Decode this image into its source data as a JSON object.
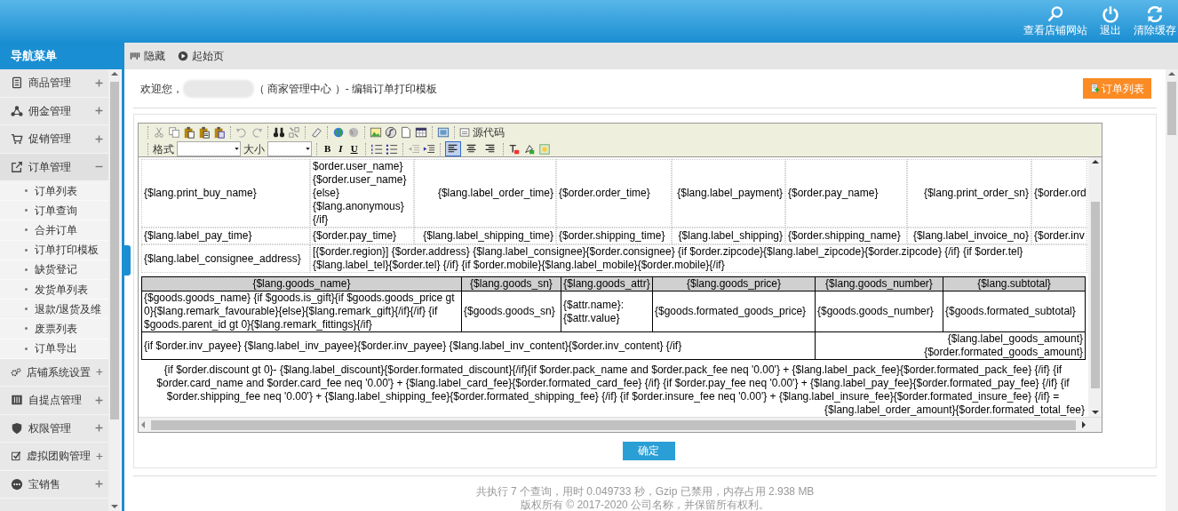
{
  "header": {
    "actions": [
      {
        "kind": "search",
        "label": "查看店铺网站"
      },
      {
        "kind": "power",
        "label": "退出"
      },
      {
        "kind": "refresh",
        "label": "清除缓存"
      }
    ]
  },
  "sidebar": {
    "title": "导航菜单",
    "items": [
      {
        "label": "商品管理",
        "expanded": false
      },
      {
        "label": "佣金管理",
        "expanded": false
      },
      {
        "label": "促销管理",
        "expanded": false
      },
      {
        "label": "订单管理",
        "expanded": true,
        "children": [
          {
            "label": "订单列表"
          },
          {
            "label": "订单查询"
          },
          {
            "label": "合并订单"
          },
          {
            "label": "订单打印模板"
          },
          {
            "label": "缺货登记"
          },
          {
            "label": "发货单列表"
          },
          {
            "label": "退款/退货及维"
          },
          {
            "label": "废票列表"
          },
          {
            "label": "订单导出"
          }
        ]
      },
      {
        "label": "店铺系统设置",
        "expanded": false
      },
      {
        "label": "自提点管理",
        "expanded": false
      },
      {
        "label": "权限管理",
        "expanded": false
      },
      {
        "label": "虚拟团购管理",
        "expanded": false
      },
      {
        "label": "宝销售",
        "expanded": false
      }
    ]
  },
  "tabbar": {
    "items": [
      {
        "kind": "hide",
        "label": "隐藏"
      },
      {
        "kind": "start",
        "label": "起始页"
      }
    ]
  },
  "welcome": {
    "prefix": "欢迎您，",
    "suffix": "（ 商家管理中心 ）- 编辑订单打印模板"
  },
  "list_button": "订单列表",
  "editor": {
    "source_label": "源代码",
    "format_label": "格式",
    "size_label": "大小",
    "style_buttons": [
      "B",
      "I",
      "U"
    ],
    "align": [
      {
        "selected": true
      },
      {
        "selected": false
      },
      {
        "selected": false
      }
    ],
    "info_rows": [
      [
        "{$lang.print_buy_name}",
        "$order.user_name} {$order.user_name} {else} {$lang.anonymous} {/if}",
        "{$lang.label_order_time}",
        "{$order.order_time}",
        "{$lang.label_payment}",
        "{$order.pay_name}",
        "{$lang.print_order_sn}",
        "{$order.ord"
      ],
      [
        "{$lang.label_pay_time}",
        "{$order.pay_time}",
        "{$lang.label_shipping_time}",
        "{$order.shipping_time}",
        "{$lang.label_shipping}",
        "{$order.shipping_name}",
        "{$lang.label_invoice_no}",
        "{$order.inv"
      ],
      [
        "{$lang.label_consignee_address}",
        "[{$order.region}] {$order.address} {$lang.label_consignee}{$order.consignee}  {if $order.zipcode}{$lang.label_zipcode}{$order.zipcode} {/if} {if $order.tel} {$lang.label_tel}{$order.tel} {/if} {if $order.mobile}{$lang.label_mobile}{$order.mobile}{/if}"
      ]
    ],
    "goods_columns": [
      "{$lang.goods_name}",
      "{$lang.goods_sn}",
      "{$lang.goods_attr}",
      "{$lang.goods_price}",
      "{$lang.goods_number}",
      "{$lang.subtotal}"
    ],
    "goods_row": [
      "{$goods.goods_name} {if $goods.is_gift}{if $goods.goods_price gt 0}{$lang.remark_favourable}{else}{$lang.remark_gift}{/if}{/if} {if $goods.parent_id gt 0}{$lang.remark_fittings}{/if}",
      "{$goods.goods_sn}",
      "{$attr.name}: {$attr.value}",
      "{$goods.formated_goods_price}",
      "{$goods.goods_number}",
      "{$goods.formated_subtotal}"
    ],
    "invoice": "{if $order.inv_payee} {$lang.label_inv_payee}{$order.inv_payee}    {$lang.label_inv_content}{$order.inv_content} {/if}",
    "goods_amount": [
      "{$lang.label_goods_amount}",
      "{$order.formated_goods_amount}"
    ],
    "summary": [
      "{if $order.discount gt 0}- {$lang.label_discount}{$order.formated_discount}{/if}{if $order.pack_name and $order.pack_fee neq '0.00'} + {$lang.label_pack_fee}{$order.formated_pack_fee} {/if} {if",
      "$order.card_name and $order.card_fee neq '0.00'} + {$lang.label_card_fee}{$order.formated_card_fee} {/if} {if $order.pay_fee neq '0.00'} + {$lang.label_pay_fee}{$order.formated_pay_fee} {/if} {if",
      "$order.shipping_fee neq '0.00'} + {$lang.label_shipping_fee}{$order.formated_shipping_fee} {/if} {if $order.insure_fee neq '0.00'} + {$lang.label_insure_fee}{$order.formated_insure_fee} {/if} =",
      "{$lang.label_order_amount}{$order.formated_total_fee}"
    ]
  },
  "submit_button": "确定",
  "footer": [
    "共执行 7 个查询，用时 0.049733 秒，Gzip 已禁用，内存占用 2.938 MB",
    "版权所有 © 2017-2020 公司名称，并保留所有权利。"
  ]
}
